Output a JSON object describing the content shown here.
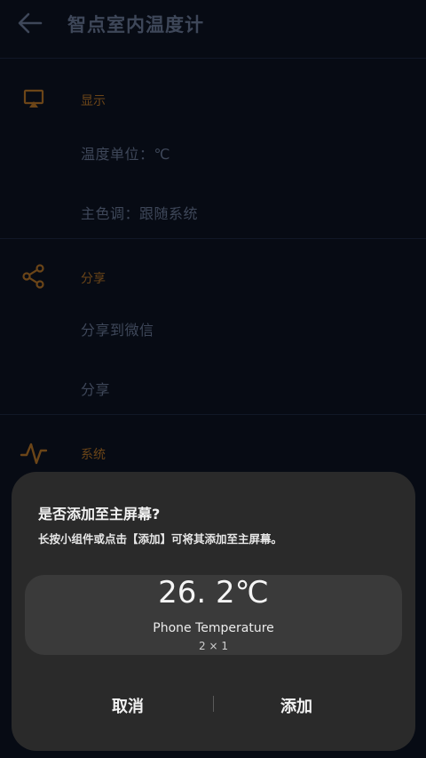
{
  "header": {
    "title": "智点室内温度计",
    "back_icon": "arrow-left-icon"
  },
  "sections": [
    {
      "icon": "cast-display-icon",
      "title": "显示",
      "items": [
        "温度单位：℃",
        "主色调：跟随系统"
      ]
    },
    {
      "icon": "share-icon",
      "title": "分享",
      "items": [
        "分享到微信",
        "分享"
      ]
    },
    {
      "icon": "pulse-wave-icon",
      "title": "系统",
      "items": []
    }
  ],
  "dialog": {
    "title": "是否添加至主屏幕?",
    "description": "长按小组件或点击【添加】可将其添加至主屏幕。",
    "widget": {
      "temperature": "26. 2℃",
      "name": "Phone Temperature",
      "size": "2 × 1"
    },
    "cancel_label": "取消",
    "add_label": "添加"
  },
  "colors": {
    "background": "#070b14",
    "accent_orange": "#6b4518",
    "muted_text": "#3e4759",
    "sheet_bg": "#2a2a2a",
    "card_bg": "#3a3a3a"
  }
}
